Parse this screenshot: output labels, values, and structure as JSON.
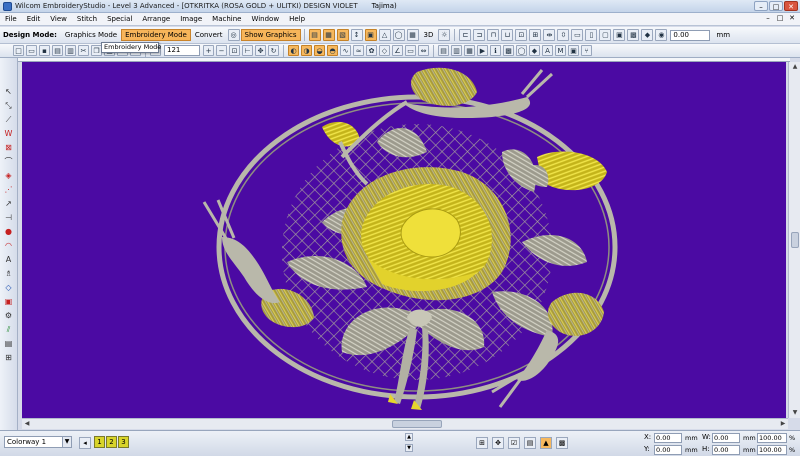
{
  "window": {
    "title": "Wilcom EmbroideryStudio - Level 3 Advanced - [OTKRITKA  (ROSA GOLD + ULITKI) DESIGN VIOLET",
    "machine": "Tajima)",
    "controls": {
      "minimize": "–",
      "maximize": "□",
      "close": "✕"
    }
  },
  "menu": {
    "items": [
      "File",
      "Edit",
      "View",
      "Stitch",
      "Special",
      "Arrange",
      "Image",
      "Machine",
      "Window",
      "Help"
    ],
    "mdi_controls": [
      "–",
      "□",
      "✕"
    ]
  },
  "toolbar1": {
    "design_mode_label": "Design Mode:",
    "graphics_mode": "Graphics Mode",
    "embroidery_mode": "Embroidery Mode",
    "convert": "Convert",
    "show_graphics": "Show Graphics",
    "three_d": "3D",
    "unit_value": "0.00",
    "unit": "mm"
  },
  "toolbar2": {
    "zoom_value": "121"
  },
  "dropdown": {
    "text": "Embroidery Mode"
  },
  "canvas": {
    "background": "#4b0aa3",
    "stitch_gold": "#e6d52c",
    "stitch_silver": "#b7b7a8"
  },
  "status": {
    "colorway": "Colorway 1",
    "swatches": [
      "1",
      "2",
      "3"
    ],
    "x_label": "X:",
    "y_label": "Y:",
    "w_label": "W:",
    "h_label": "H:",
    "x_value": "0.00",
    "y_value": "0.00",
    "w_value": "0.00",
    "h_value": "0.00",
    "w_pct": "100.00",
    "h_pct": "100.00",
    "unit_mm": "mm",
    "unit_pct": "%"
  }
}
